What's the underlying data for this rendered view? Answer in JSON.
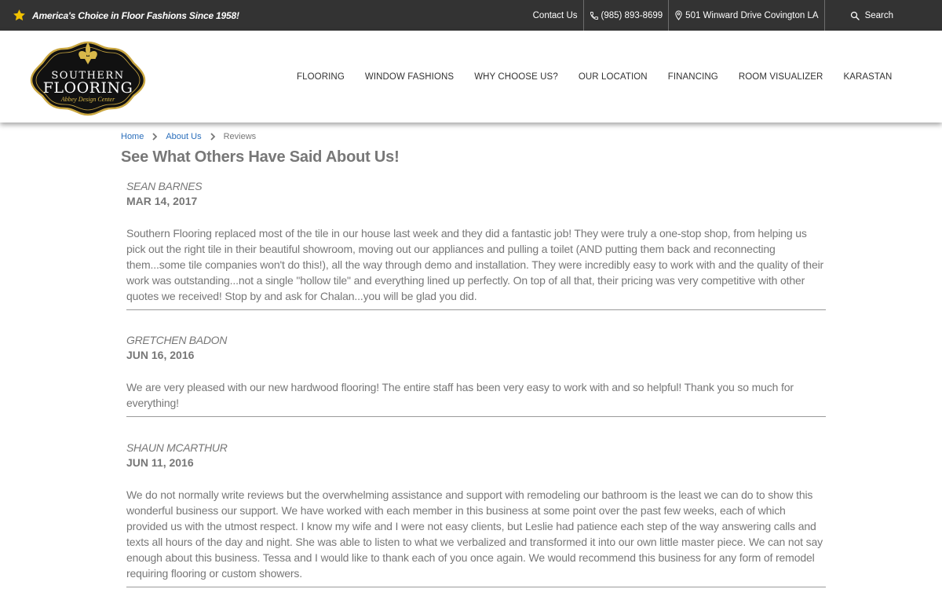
{
  "topbar": {
    "tagline": "America's Choice in Floor Fashions Since 1958!",
    "contact_label": "Contact Us",
    "phone": "(985) 893-8699",
    "address": "501 Winward Drive Covington LA",
    "search_label": "Search"
  },
  "logo": {
    "line1": "SOUTHERN",
    "line2": "FLOORING",
    "line3": "Abbey Design Center"
  },
  "nav": {
    "items": [
      {
        "label": "FLOORING"
      },
      {
        "label": "WINDOW FASHIONS"
      },
      {
        "label": "WHY CHOOSE US?"
      },
      {
        "label": "OUR LOCATION"
      },
      {
        "label": "FINANCING"
      },
      {
        "label": "ROOM VISUALIZER"
      },
      {
        "label": "KARASTAN"
      }
    ]
  },
  "breadcrumb": {
    "home": "Home",
    "about": "About Us",
    "current": "Reviews"
  },
  "page": {
    "title": "See What Others Have Said About Us!"
  },
  "reviews": [
    {
      "name": "SEAN BARNES",
      "date": "MAR 14, 2017",
      "text": "Southern Flooring replaced most of the tile in our house last week and they did a fantastic job! They were truly a one-stop shop, from helping us pick out the right tile in their beautiful showroom, moving out our appliances and pulling a toilet (AND putting them back and reconnecting them...some tile companies won't do this!), all the way through demo and installation. They were incredibly easy to work with and the quality of their work was outstanding...not a single \"hollow tile\" and everything lined up perfectly. On top of all that, their pricing was very competitive with other quotes we received! Stop by and ask for Chalan...you will be glad you did."
    },
    {
      "name": "GRETCHEN BADON",
      "date": "JUN 16, 2016",
      "text": "We are very pleased with our new hardwood flooring! The entire staff has been very easy to work with and so helpful! Thank you so much for everything!"
    },
    {
      "name": "SHAUN MCARTHUR",
      "date": "JUN 11, 2016",
      "text": "We do not normally write reviews but the overwhelming assistance and support with remodeling our bathroom is the least we can do to show this wonderful business our support. We have worked with each member in this business at some point over the past few weeks, each of which provided us with the utmost respect. I know my wife and I were not easy clients, but Leslie had patience each step of the way answering calls and texts all hours of the day and night. She was able to listen to what we verbalized and transformed it into our own little master piece. We can not say enough about this business. Tessa and I would like to thank each of you once again. We would recommend this business for any form of remodel requiring flooring or custom showers."
    }
  ],
  "colors": {
    "topbar_bg": "#333333",
    "star": "#f2c200",
    "link": "#2a6ebb",
    "logo_gold": "#c9a640",
    "text_gray": "#777777"
  }
}
